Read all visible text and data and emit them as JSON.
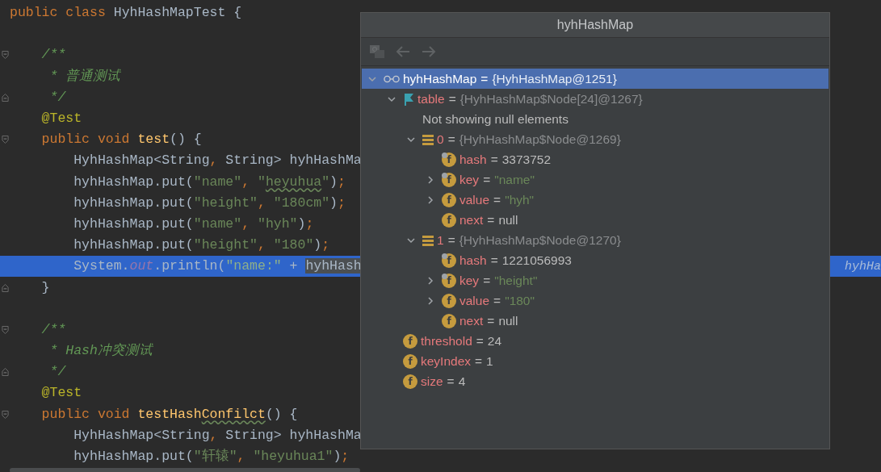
{
  "code": {
    "lines": [
      {
        "current": false,
        "tokens": [
          {
            "kind": "keyword",
            "text": "public class "
          },
          {
            "kind": "plain",
            "text": "HyhHashMapTest {"
          }
        ]
      },
      {
        "current": false
      },
      {
        "current": false,
        "fold": {
          "kind": "start"
        },
        "tokens": [
          {
            "kind": "comment",
            "text": "    /**"
          }
        ]
      },
      {
        "current": false,
        "tokens": [
          {
            "kind": "comment",
            "text": "     * 普通测试"
          }
        ]
      },
      {
        "current": false,
        "fold": {
          "kind": "end"
        },
        "tokens": [
          {
            "kind": "comment",
            "text": "     */"
          }
        ]
      },
      {
        "current": false,
        "tokens": [
          {
            "kind": "annotation",
            "text": "    @Test"
          }
        ]
      },
      {
        "current": false,
        "fold": {
          "kind": "start"
        },
        "tokens": [
          {
            "kind": "keyword",
            "text": "    public void "
          },
          {
            "kind": "method",
            "text": "test"
          },
          {
            "kind": "plain",
            "text": "() {"
          }
        ]
      },
      {
        "current": false,
        "tokens": [
          {
            "kind": "plain",
            "text": "        HyhHashMap<String"
          },
          {
            "kind": "punct",
            "text": ","
          },
          {
            "kind": "plain",
            "text": " String> hyhHashMa"
          }
        ]
      },
      {
        "current": false,
        "tokens": [
          {
            "kind": "plain",
            "text": "        hyhHashMap.put("
          },
          {
            "kind": "string",
            "text": "\"name\""
          },
          {
            "kind": "punct",
            "text": ", "
          },
          {
            "kind": "string",
            "text": "\""
          },
          {
            "kind": "typo_string",
            "text": "heyuhua"
          },
          {
            "kind": "string",
            "text": "\""
          },
          {
            "kind": "plain",
            "text": ")"
          },
          {
            "kind": "punct",
            "text": ";"
          }
        ]
      },
      {
        "current": false,
        "tokens": [
          {
            "kind": "plain",
            "text": "        hyhHashMap.put("
          },
          {
            "kind": "string",
            "text": "\"height\""
          },
          {
            "kind": "punct",
            "text": ", "
          },
          {
            "kind": "string",
            "text": "\"180cm\""
          },
          {
            "kind": "plain",
            "text": ")"
          },
          {
            "kind": "punct",
            "text": ";"
          }
        ]
      },
      {
        "current": false,
        "tokens": [
          {
            "kind": "plain",
            "text": "        hyhHashMap.put("
          },
          {
            "kind": "string",
            "text": "\"name\""
          },
          {
            "kind": "punct",
            "text": ", "
          },
          {
            "kind": "string",
            "text": "\"hyh\""
          },
          {
            "kind": "plain",
            "text": ")"
          },
          {
            "kind": "punct",
            "text": ";"
          }
        ]
      },
      {
        "current": false,
        "tokens": [
          {
            "kind": "plain",
            "text": "        hyhHashMap.put("
          },
          {
            "kind": "string",
            "text": "\"height\""
          },
          {
            "kind": "punct",
            "text": ", "
          },
          {
            "kind": "string",
            "text": "\"180\""
          },
          {
            "kind": "plain",
            "text": ")"
          },
          {
            "kind": "punct",
            "text": ";"
          }
        ]
      },
      {
        "current": true,
        "hint": "hyhHa",
        "tokens": [
          {
            "kind": "plain",
            "text": "        System."
          },
          {
            "kind": "field",
            "text": "out"
          },
          {
            "kind": "plain",
            "text": ".println("
          },
          {
            "kind": "string",
            "text": "\"name:\""
          },
          {
            "kind": "plain",
            "text": " + "
          },
          {
            "kind": "selection",
            "text": "hyhHash"
          }
        ]
      },
      {
        "current": false,
        "fold": {
          "kind": "end"
        },
        "tokens": [
          {
            "kind": "plain",
            "text": "    }"
          }
        ]
      },
      {
        "current": false
      },
      {
        "current": false,
        "fold": {
          "kind": "start"
        },
        "tokens": [
          {
            "kind": "comment",
            "text": "    /**"
          }
        ]
      },
      {
        "current": false,
        "tokens": [
          {
            "kind": "comment",
            "text": "     * Hash冲突测试"
          }
        ]
      },
      {
        "current": false,
        "fold": {
          "kind": "end"
        },
        "tokens": [
          {
            "kind": "comment",
            "text": "     */"
          }
        ]
      },
      {
        "current": false,
        "tokens": [
          {
            "kind": "annotation",
            "text": "    @Test"
          }
        ]
      },
      {
        "current": false,
        "fold": {
          "kind": "start"
        },
        "tokens": [
          {
            "kind": "keyword",
            "text": "    public void "
          },
          {
            "kind": "method",
            "text": "testHash"
          },
          {
            "kind": "typo_method",
            "text": "Confilct"
          },
          {
            "kind": "plain",
            "text": "() {"
          }
        ]
      },
      {
        "current": false,
        "tokens": [
          {
            "kind": "plain",
            "text": "        HyhHashMap<String"
          },
          {
            "kind": "punct",
            "text": ","
          },
          {
            "kind": "plain",
            "text": " String> hyhHashMa"
          }
        ]
      },
      {
        "current": false,
        "tokens": [
          {
            "kind": "plain",
            "text": "        hyhHashMap.put("
          },
          {
            "kind": "string",
            "text": "\"轩辕\""
          },
          {
            "kind": "punct",
            "text": ", "
          },
          {
            "kind": "string",
            "text": "\"heyuhua1\""
          },
          {
            "kind": "plain",
            "text": ")"
          },
          {
            "kind": "punct",
            "text": ";"
          }
        ]
      }
    ]
  },
  "popup": {
    "title": "hyhHashMap",
    "tree": [
      {
        "kind": "object",
        "name": "hyhHashMap",
        "sep": "=",
        "value": {
          "kind": "ref",
          "text": "{HyhHashMap@1251}"
        },
        "expanded": true,
        "selected": true,
        "children": [
          {
            "kind": "array",
            "name": "table",
            "sep": "=",
            "value": {
              "kind": "ref",
              "text": "{HyhHashMap$Node[24]@1267}"
            },
            "expanded": true,
            "selected": false,
            "children": [
              {
                "kind": "info",
                "text": "Not showing null elements",
                "selected": false
              },
              {
                "kind": "element",
                "name": "0",
                "sep": "=",
                "value": {
                  "kind": "ref",
                  "text": "{HyhHashMap$Node@1269}"
                },
                "expanded": true,
                "selected": false,
                "children": [
                  {
                    "kind": "field",
                    "icon_text": "f",
                    "overlay": true,
                    "name": "hash",
                    "sep": "=",
                    "value": {
                      "kind": "plain",
                      "text": "3373752"
                    },
                    "selected": false
                  },
                  {
                    "kind": "field",
                    "icon_text": "f",
                    "overlay": true,
                    "name": "key",
                    "sep": "=",
                    "value": {
                      "kind": "string",
                      "text": "\"name\""
                    },
                    "expanded": false,
                    "selected": false
                  },
                  {
                    "kind": "field",
                    "icon_text": "f",
                    "overlay": false,
                    "name": "value",
                    "sep": "=",
                    "value": {
                      "kind": "string",
                      "text": "\"hyh\""
                    },
                    "expanded": false,
                    "selected": false
                  },
                  {
                    "kind": "field",
                    "icon_text": "f",
                    "overlay": false,
                    "name": "next",
                    "sep": "=",
                    "value": {
                      "kind": "plain",
                      "text": "null"
                    },
                    "selected": false
                  }
                ]
              },
              {
                "kind": "element",
                "name": "1",
                "sep": "=",
                "value": {
                  "kind": "ref",
                  "text": "{HyhHashMap$Node@1270}"
                },
                "expanded": true,
                "selected": false,
                "children": [
                  {
                    "kind": "field",
                    "icon_text": "f",
                    "overlay": true,
                    "name": "hash",
                    "sep": "=",
                    "value": {
                      "kind": "plain",
                      "text": "1221056993"
                    },
                    "selected": false
                  },
                  {
                    "kind": "field",
                    "icon_text": "f",
                    "overlay": true,
                    "name": "key",
                    "sep": "=",
                    "value": {
                      "kind": "string",
                      "text": "\"height\""
                    },
                    "expanded": false,
                    "selected": false
                  },
                  {
                    "kind": "field",
                    "icon_text": "f",
                    "overlay": false,
                    "name": "value",
                    "sep": "=",
                    "value": {
                      "kind": "string",
                      "text": "\"180\""
                    },
                    "expanded": false,
                    "selected": false
                  },
                  {
                    "kind": "field",
                    "icon_text": "f",
                    "overlay": false,
                    "name": "next",
                    "sep": "=",
                    "value": {
                      "kind": "plain",
                      "text": "null"
                    },
                    "selected": false
                  }
                ]
              }
            ]
          },
          {
            "kind": "field",
            "icon_text": "f",
            "overlay": false,
            "name": "threshold",
            "sep": "=",
            "value": {
              "kind": "plain",
              "text": "24"
            },
            "selected": false
          },
          {
            "kind": "field",
            "icon_text": "f",
            "overlay": false,
            "name": "keyIndex",
            "sep": "=",
            "value": {
              "kind": "plain",
              "text": "1"
            },
            "selected": false
          },
          {
            "kind": "field",
            "icon_text": "f",
            "overlay": false,
            "name": "size",
            "sep": "=",
            "value": {
              "kind": "plain",
              "text": "4"
            },
            "selected": false
          }
        ]
      }
    ]
  }
}
